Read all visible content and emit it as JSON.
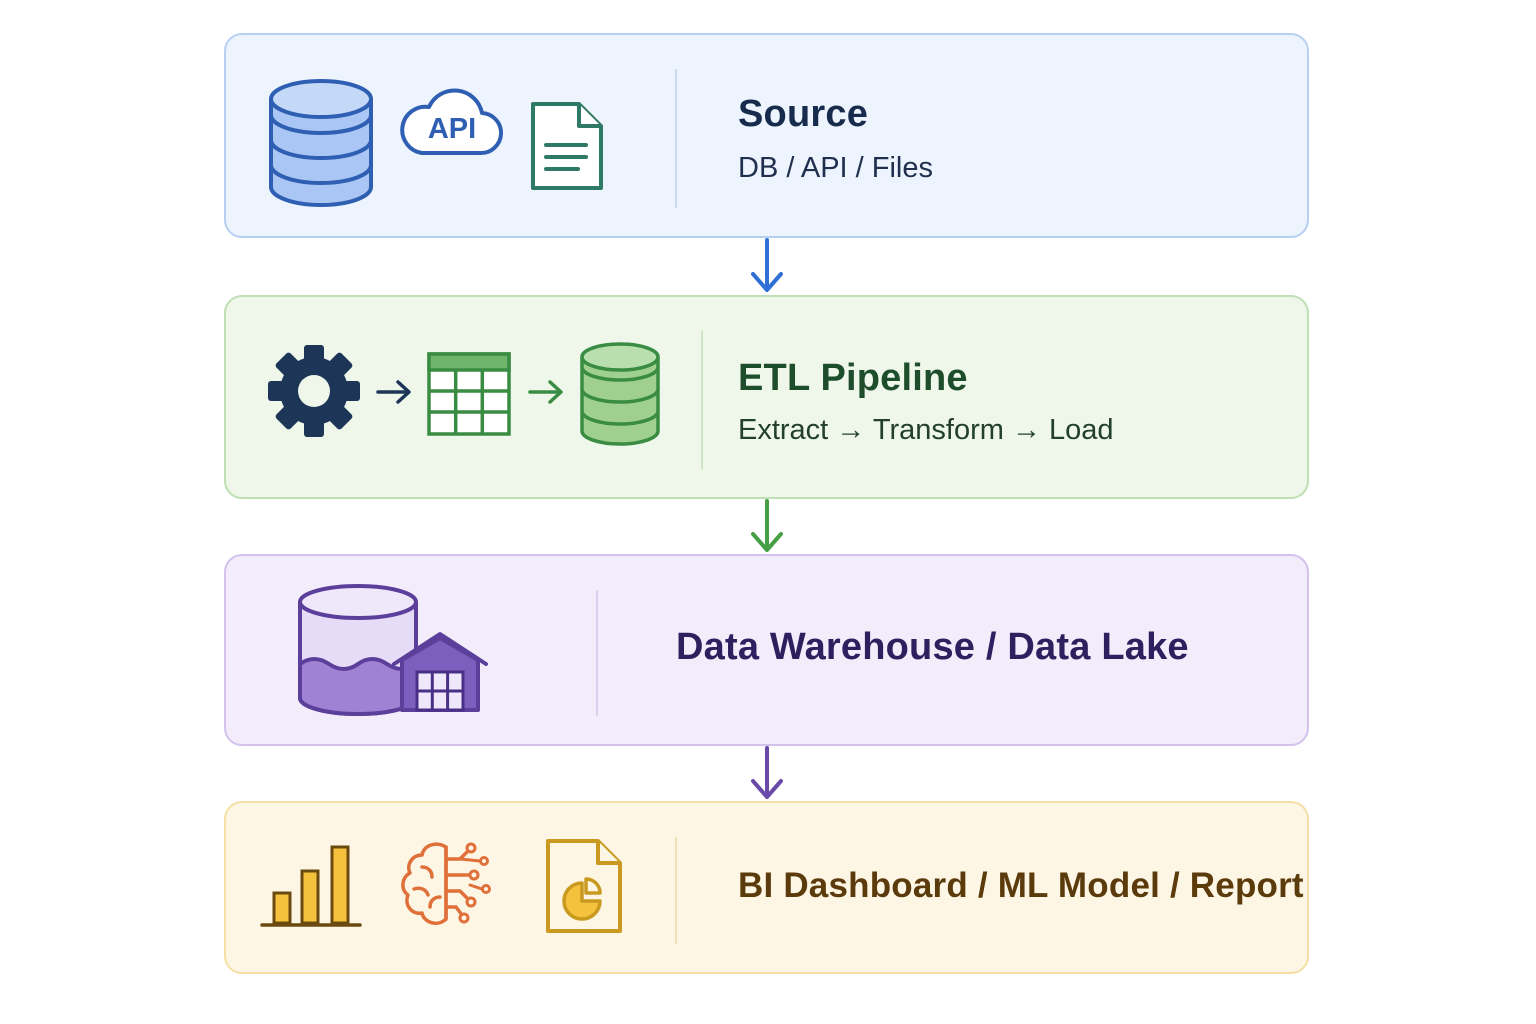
{
  "stages": [
    {
      "id": "source",
      "title": "Source",
      "subtitle": "DB / API / Files",
      "icons": [
        "database-icon",
        "api-cloud-icon",
        "file-document-icon"
      ],
      "api_badge": "API",
      "colors": {
        "accent": "#2f5fb3",
        "fill": "#a9c6f5",
        "background": "#edf4fd",
        "border": "#b7d0f2"
      }
    },
    {
      "id": "etl",
      "title": "ETL Pipeline",
      "subtitle": "Extract → Transform → Load",
      "icons": [
        "gear-icon",
        "arrow-right-icon",
        "table-grid-icon",
        "arrow-right-icon",
        "database-icon"
      ],
      "colors": {
        "accent": "#3a8c43",
        "fill": "#9fd08f",
        "background": "#eef7ea",
        "border": "#bfdfb4"
      }
    },
    {
      "id": "warehouse",
      "title": "Data Warehouse / Data Lake",
      "subtitle": "",
      "icons": [
        "data-lake-cylinder-icon",
        "warehouse-icon"
      ],
      "colors": {
        "accent": "#5b3f9a",
        "fill": "#9f82d4",
        "background": "#f2ecfb",
        "border": "#d4c2ee"
      }
    },
    {
      "id": "output",
      "title": "BI Dashboard / ML Model / Report",
      "subtitle": "",
      "icons": [
        "bar-chart-icon",
        "brain-circuit-icon",
        "report-pie-icon"
      ],
      "colors": {
        "accent": "#c99a1f",
        "fill": "#f4c23c",
        "background": "#fef6e4",
        "border": "#f6dfa5"
      }
    }
  ],
  "connectors": [
    {
      "from": "source",
      "to": "etl",
      "color": "#2f6fd6"
    },
    {
      "from": "etl",
      "to": "warehouse",
      "color": "#45a045"
    },
    {
      "from": "warehouse",
      "to": "output",
      "color": "#6a4aa8"
    }
  ]
}
